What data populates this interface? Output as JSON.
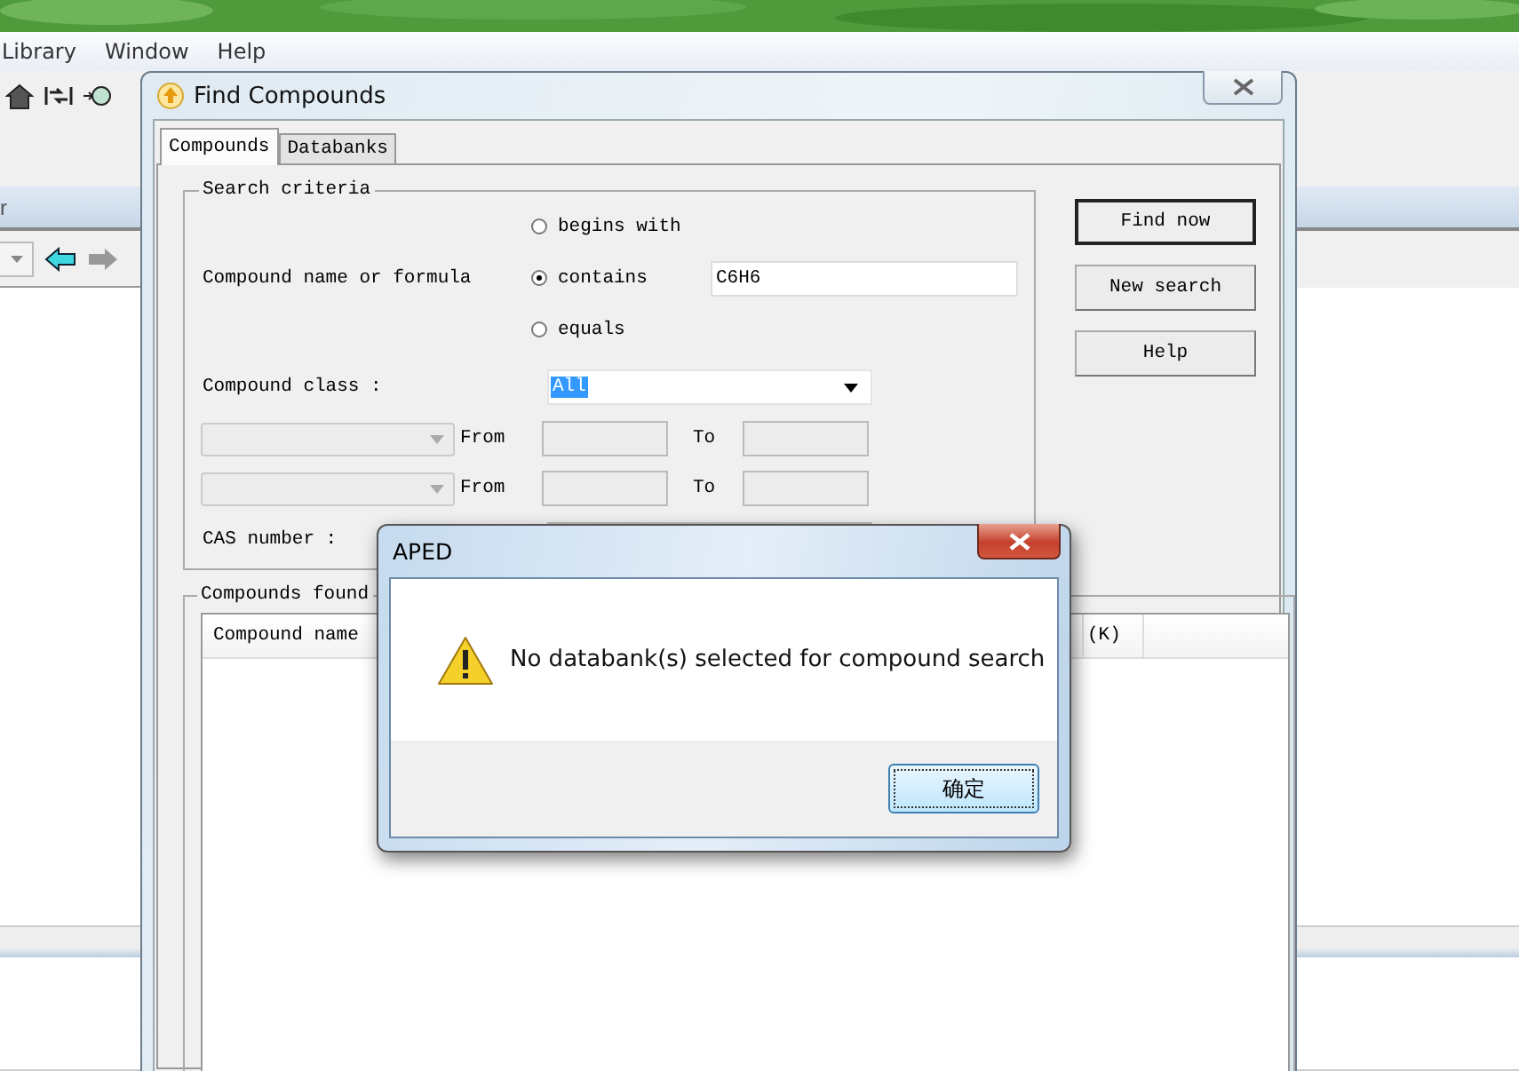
{
  "app": {
    "menu": [
      {
        "label": "Library"
      },
      {
        "label": "Window"
      },
      {
        "label": "Help"
      }
    ],
    "pane_header": "r"
  },
  "find_window": {
    "title": "Find Compounds",
    "tabs": [
      {
        "label": "Compounds",
        "selected": true
      },
      {
        "label": "Databanks",
        "selected": false
      }
    ],
    "search_criteria": {
      "legend": "Search criteria",
      "name_label": "Compound name or formula",
      "match_options": [
        {
          "label": "begins with",
          "selected": false
        },
        {
          "label": "contains",
          "selected": true
        },
        {
          "label": "equals",
          "selected": false
        }
      ],
      "name_value": "C6H6",
      "class_label": "Compound class :",
      "class_value": "All",
      "ranges": [
        {
          "from_label": "From",
          "to_label": "To",
          "disabled": true
        },
        {
          "from_label": "From",
          "to_label": "To",
          "disabled": true
        }
      ],
      "cas_label": "CAS number :"
    },
    "buttons": [
      {
        "label": "Find now",
        "default": true
      },
      {
        "label": "New search",
        "default": false
      },
      {
        "label": "Help",
        "default": false
      }
    ],
    "results": {
      "legend": "Compounds found",
      "columns": [
        "Compound name",
        "(K)"
      ]
    }
  },
  "dialog": {
    "title": "APED",
    "message": "No databank(s) selected for compound search",
    "button": "确定"
  }
}
